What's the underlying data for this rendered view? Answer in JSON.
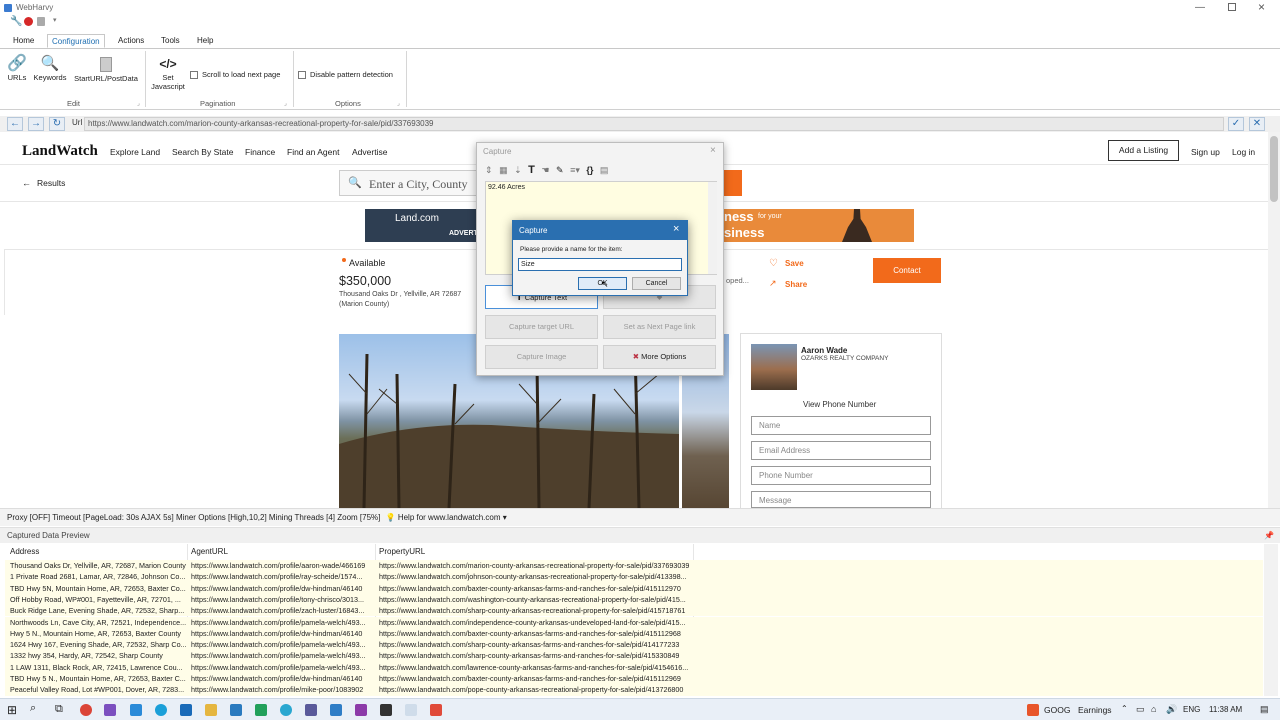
{
  "app": {
    "title": "WebHarvy"
  },
  "ribbon_tabs": [
    {
      "label": "Home"
    },
    {
      "label": "Configuration"
    },
    {
      "label": "Actions"
    },
    {
      "label": "Tools"
    },
    {
      "label": "Help"
    }
  ],
  "ribbon": {
    "urls": "URLs",
    "keywords": "Keywords",
    "starturl": "StartURL/PostData",
    "set_js_1": "Set",
    "set_js_2": "Javascript",
    "scroll_label": "Scroll to load next page",
    "disable_label": "Disable pattern detection",
    "group_edit": "Edit",
    "group_pagination": "Pagination",
    "group_options": "Options"
  },
  "urlbar": {
    "label": "Url",
    "value": "https://www.landwatch.com/marion-county-arkansas-recreational-property-for-sale/pid/337693039"
  },
  "site": {
    "logo": "LandWatch",
    "nav": [
      "Explore Land",
      "Search By State",
      "Finance",
      "Find an Agent",
      "Advertise"
    ],
    "add_listing": "Add a Listing",
    "signup": "Sign up",
    "login": "Log in",
    "results": "Results",
    "search_placeholder": "Enter a City, County",
    "ad_left": "Land.com",
    "ad_left_sub": "ADVERT",
    "ad_right_1": "ness",
    "ad_right_small": "for your",
    "ad_right_2": "siness",
    "available": "Available",
    "price": "$350,000",
    "address": "Thousand Oaks Dr , Yellville, AR 72687",
    "county": "(Marion County)",
    "save": "Save",
    "share": "Share",
    "contact": "Contact",
    "peek_text": "oped...",
    "agent_name": "Aaron Wade",
    "agent_company": "OZARKS REALTY COMPANY",
    "view_phone": "View Phone Number",
    "form": {
      "name": "Name",
      "email": "Email Address",
      "phone": "Phone Number",
      "message": "Message"
    }
  },
  "capture_dialog": {
    "title": "Capture",
    "preview_text": "92.46 Acres",
    "capture_text": "Capture Text",
    "capture_target_url": "Capture target URL",
    "set_as_next_page": "Set as Next Page link",
    "capture_image": "Capture Image",
    "more_options": "More Options"
  },
  "name_dialog": {
    "title": "Capture",
    "prompt": "Please provide a name for the item:",
    "value": "Size",
    "ok": "OK",
    "cancel": "Cancel"
  },
  "status_bar": {
    "text": "Proxy [OFF] Timeout [PageLoad: 30s AJAX 5s] Miner Options [High,10,2] Mining Threads [4] Zoom [75%]",
    "help": "Help for www.landwatch.com"
  },
  "captured_preview": {
    "title": "Captured Data Preview",
    "columns": [
      "Address",
      "AgentURL",
      "PropertyURL"
    ],
    "rows": [
      [
        "Thousand Oaks Dr, Yellville, AR, 72687, Marion County",
        "https://www.landwatch.com/profile/aaron-wade/466169",
        "https://www.landwatch.com/marion-county-arkansas-recreational-property-for-sale/pid/337693039"
      ],
      [
        "1 Private Road 2681, Lamar, AR, 72846, Johnson Co...",
        "https://www.landwatch.com/profile/ray-scheide/1574...",
        "https://www.landwatch.com/johnson-county-arkansas-recreational-property-for-sale/pid/413398..."
      ],
      [
        "TBD Hwy 5N, Mountain Home, AR, 72653, Baxter Co...",
        "https://www.landwatch.com/profile/dw-hindman/46140",
        "https://www.landwatch.com/baxter-county-arkansas-farms-and-ranches-for-sale/pid/415112970"
      ],
      [
        "Off Hobby Road, WP#001, Fayetteville, AR, 72701, ...",
        "https://www.landwatch.com/profile/tony-chrisco/3013...",
        "https://www.landwatch.com/washington-county-arkansas-recreational-property-for-sale/pid/415..."
      ],
      [
        "Buck Ridge Lane, Evening Shade, AR, 72532, Sharp...",
        "https://www.landwatch.com/profile/zach-luster/16843...",
        "https://www.landwatch.com/sharp-county-arkansas-recreational-property-for-sale/pid/415718761"
      ],
      [
        "Northwoods Ln, Cave City, AR, 72521, Independence...",
        "https://www.landwatch.com/profile/pamela-welch/493...",
        "https://www.landwatch.com/independence-county-arkansas-undeveloped-land-for-sale/pid/415..."
      ],
      [
        "Hwy 5 N., Mountain Home, AR, 72653, Baxter County",
        "https://www.landwatch.com/profile/dw-hindman/46140",
        "https://www.landwatch.com/baxter-county-arkansas-farms-and-ranches-for-sale/pid/415112968"
      ],
      [
        "1624 Hwy 167, Evening Shade, AR, 72532, Sharp Co...",
        "https://www.landwatch.com/profile/pamela-welch/493...",
        "https://www.landwatch.com/sharp-county-arkansas-farms-and-ranches-for-sale/pid/414177233"
      ],
      [
        "1332 hwy 354, Hardy, AR, 72542, Sharp County",
        "https://www.landwatch.com/profile/pamela-welch/493...",
        "https://www.landwatch.com/sharp-county-arkansas-farms-and-ranches-for-sale/pid/415330849"
      ],
      [
        "1 LAW 1311, Black Rock, AR, 72415, Lawrence Cou...",
        "https://www.landwatch.com/profile/pamela-welch/493...",
        "https://www.landwatch.com/lawrence-county-arkansas-farms-and-ranches-for-sale/pid/4154616..."
      ],
      [
        "TBD Hwy 5 N., Mountain Home, AR, 72653, Baxter C...",
        "https://www.landwatch.com/profile/dw-hindman/46140",
        "https://www.landwatch.com/baxter-county-arkansas-farms-and-ranches-for-sale/pid/415112969"
      ],
      [
        "Peaceful Valley Road, Lot #WP001, Dover, AR, 7283...",
        "https://www.landwatch.com/profile/mike-poor/1083902",
        "https://www.landwatch.com/pope-county-arkansas-recreational-property-for-sale/pid/413726800"
      ]
    ]
  },
  "taskbar": {
    "ticker": "GOOG",
    "earnings": "Earnings",
    "lang": "ENG",
    "time": "11:38 AM"
  },
  "colors": {
    "accent": "#1f6fb2",
    "orange": "#f26a1b",
    "dialog_title": "#2a6fb0",
    "preview_bg": "#fffde8"
  }
}
